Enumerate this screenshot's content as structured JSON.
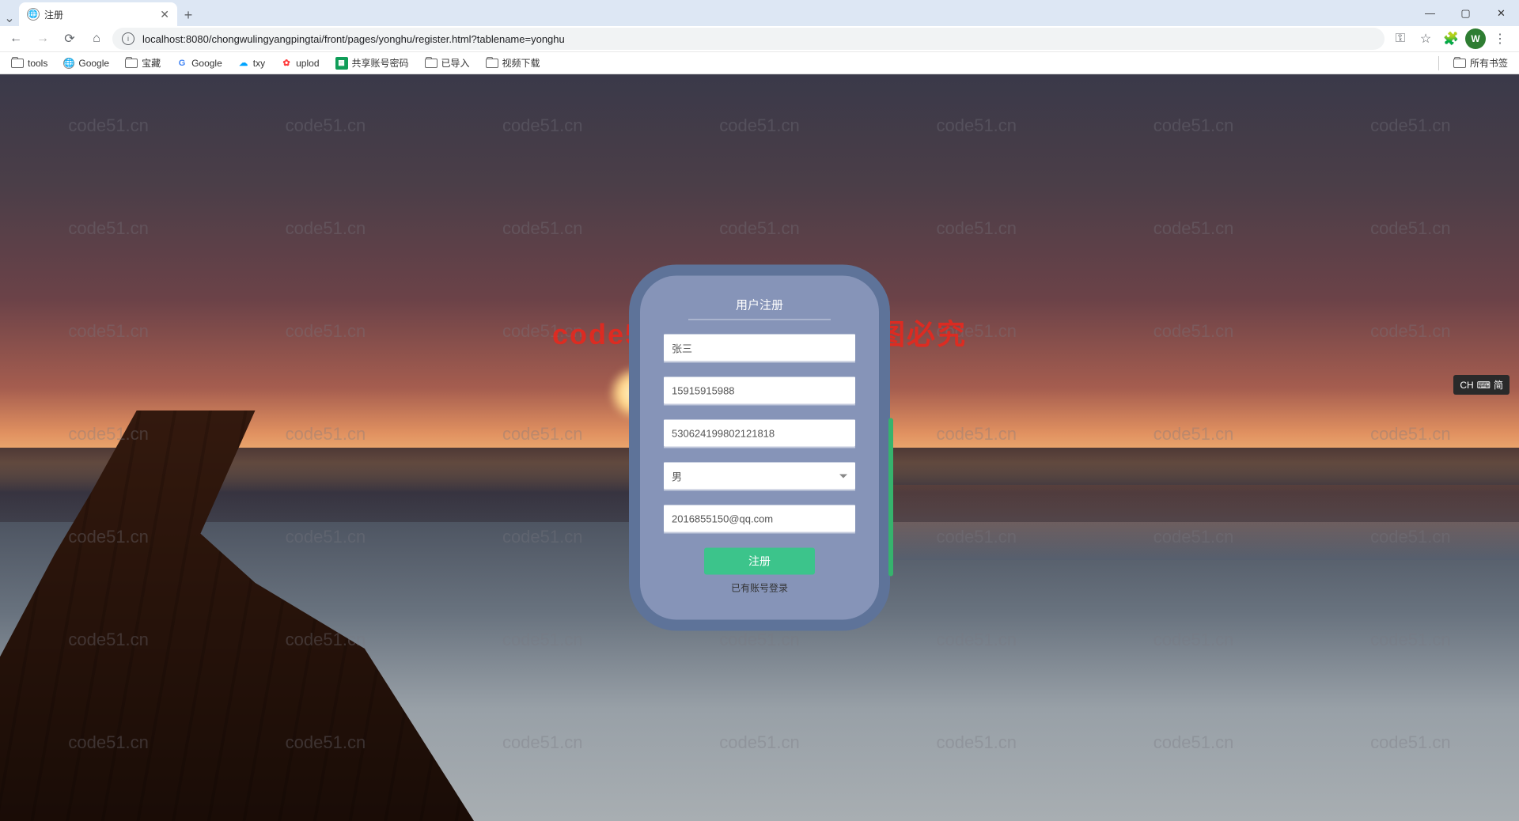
{
  "browser": {
    "tab_title": "注册",
    "url": "localhost:8080/chongwulingyangpingtai/front/pages/yonghu/register.html?tablename=yonghu",
    "avatar_letter": "W",
    "all_bookmarks_label": "所有书签"
  },
  "bookmarks": [
    {
      "label": "tools",
      "type": "folder"
    },
    {
      "label": "Google",
      "type": "globe"
    },
    {
      "label": "宝藏",
      "type": "folder"
    },
    {
      "label": "Google",
      "type": "g"
    },
    {
      "label": "txy",
      "type": "cloud"
    },
    {
      "label": "uplod",
      "type": "up"
    },
    {
      "label": "共享账号密码",
      "type": "sheet"
    },
    {
      "label": "已导入",
      "type": "folder"
    },
    {
      "label": "视频下载",
      "type": "folder"
    }
  ],
  "watermark": {
    "repeat_text": "code51.cn",
    "center_text": "code51. cn-源码乐园盗图必究"
  },
  "form": {
    "title": "用户注册",
    "name_value": "张三",
    "phone_value": "15915915988",
    "idcard_value": "530624199802121818",
    "gender_value": "男",
    "email_value": "2016855150@qq.com",
    "register_button": "注册",
    "login_link": "已有账号登录"
  },
  "ime": {
    "label": "CH",
    "mode": "简"
  }
}
